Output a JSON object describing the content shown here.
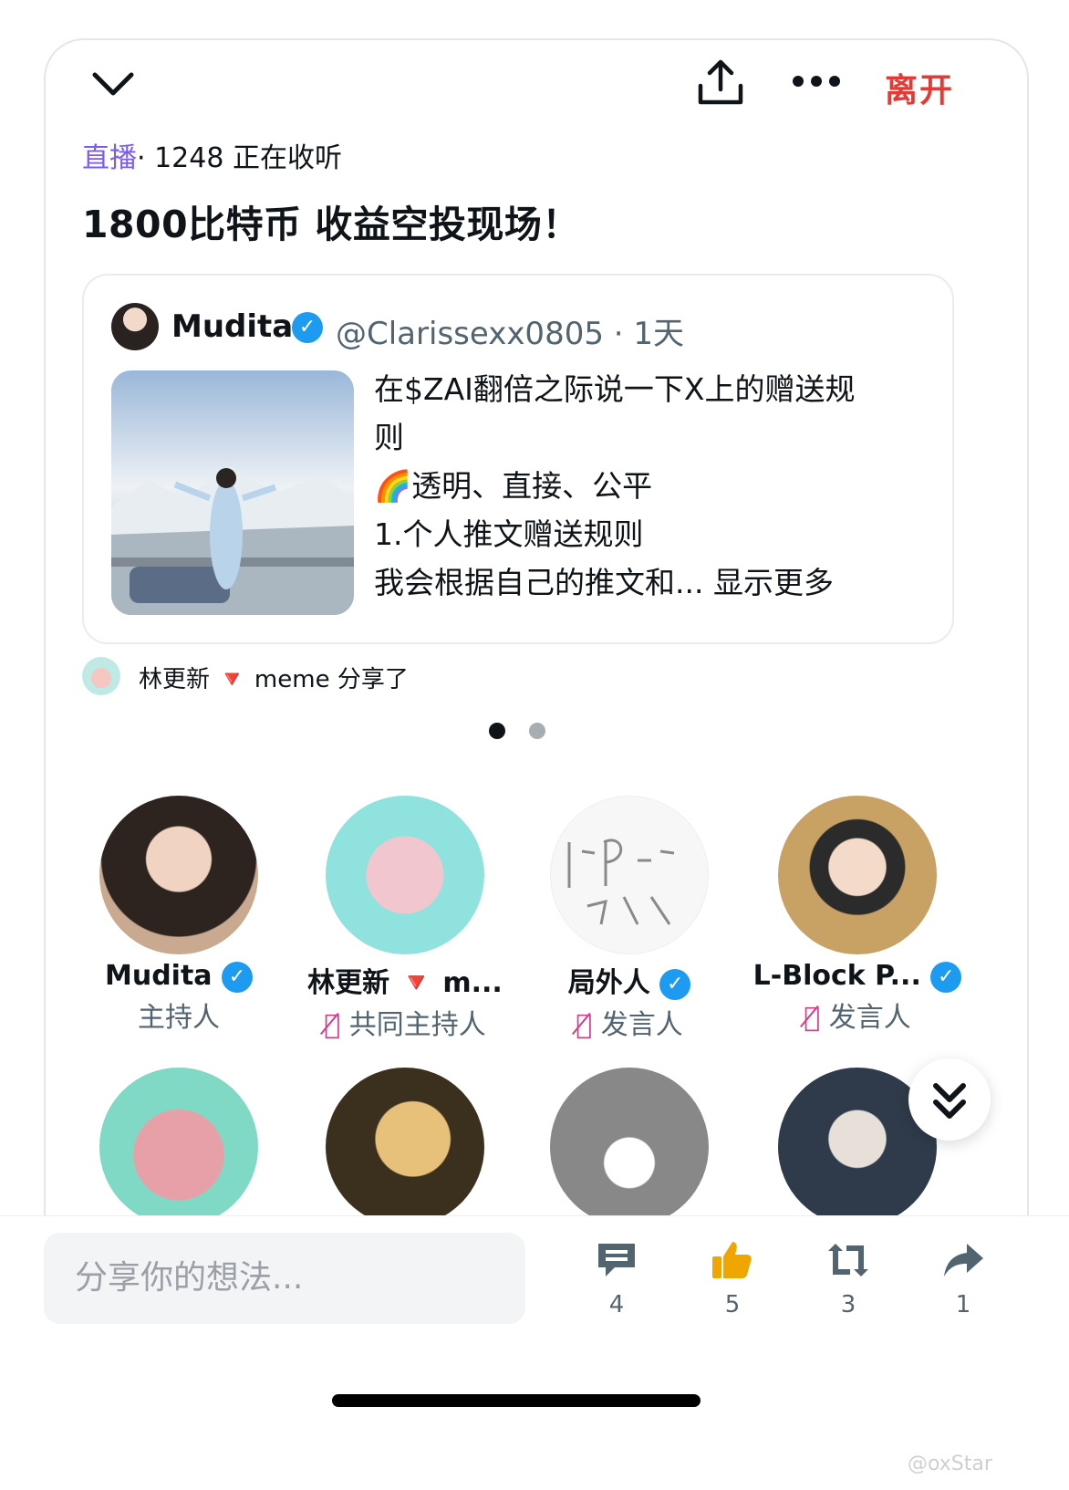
{
  "header": {
    "leave_label": "离开"
  },
  "live": {
    "tag": "直播",
    "listeners": "· 1248 正在收听"
  },
  "title": "1800比特币 收益空投现场！",
  "pinned_post": {
    "author_name": "Mudita",
    "handle": "@Clarissexx0805 · 1天",
    "lines": [
      "在$ZAI翻倍之际说一下X上的赠送规",
      "则",
      "🌈透明、直接、公平",
      "1.个人推文赠送规则"
    ],
    "last_line": "我会根据自己的推文和...",
    "show_more": "显示更多"
  },
  "shared_by": {
    "name": "林更新",
    "rest": "meme 分享了"
  },
  "carousel": {
    "pages": 2,
    "active": 1
  },
  "speakers": [
    {
      "name": "Mudita",
      "role": "主持人",
      "verified": true,
      "muted": false,
      "avatar_color": "#3a2e2a"
    },
    {
      "name": "林更新 🔻 m...",
      "role": "共同主持人",
      "verified": false,
      "muted": true,
      "avatar_color": "#8fe2dd"
    },
    {
      "name": "局外人",
      "role": "发言人",
      "verified": true,
      "muted": true,
      "avatar_color": "#f7f7f7"
    },
    {
      "name": "L-Block P...",
      "role": "发言人",
      "verified": true,
      "muted": true,
      "avatar_color": "#c8a165"
    }
  ],
  "listeners_row": [
    {
      "avatar_color": "#7fd9c4"
    },
    {
      "avatar_color": "#3b2f1e"
    },
    {
      "avatar_color": "#888888"
    },
    {
      "avatar_color": "#4a5a70"
    }
  ],
  "composer": {
    "placeholder": "分享你的想法..."
  },
  "actions": [
    {
      "icon": "comment-icon",
      "count": "4"
    },
    {
      "icon": "thumbs-up-icon",
      "count": "5"
    },
    {
      "icon": "retweet-icon",
      "count": "3"
    },
    {
      "icon": "share-arrow-icon",
      "count": "1"
    }
  ],
  "watermark": "@oxStar",
  "colors": {
    "accent_purple": "#7a5cf0",
    "leave_red": "#e53935",
    "verified_blue": "#1d9bf0",
    "like_orange": "#f0a500",
    "mic_pink": "#d63a8c"
  }
}
